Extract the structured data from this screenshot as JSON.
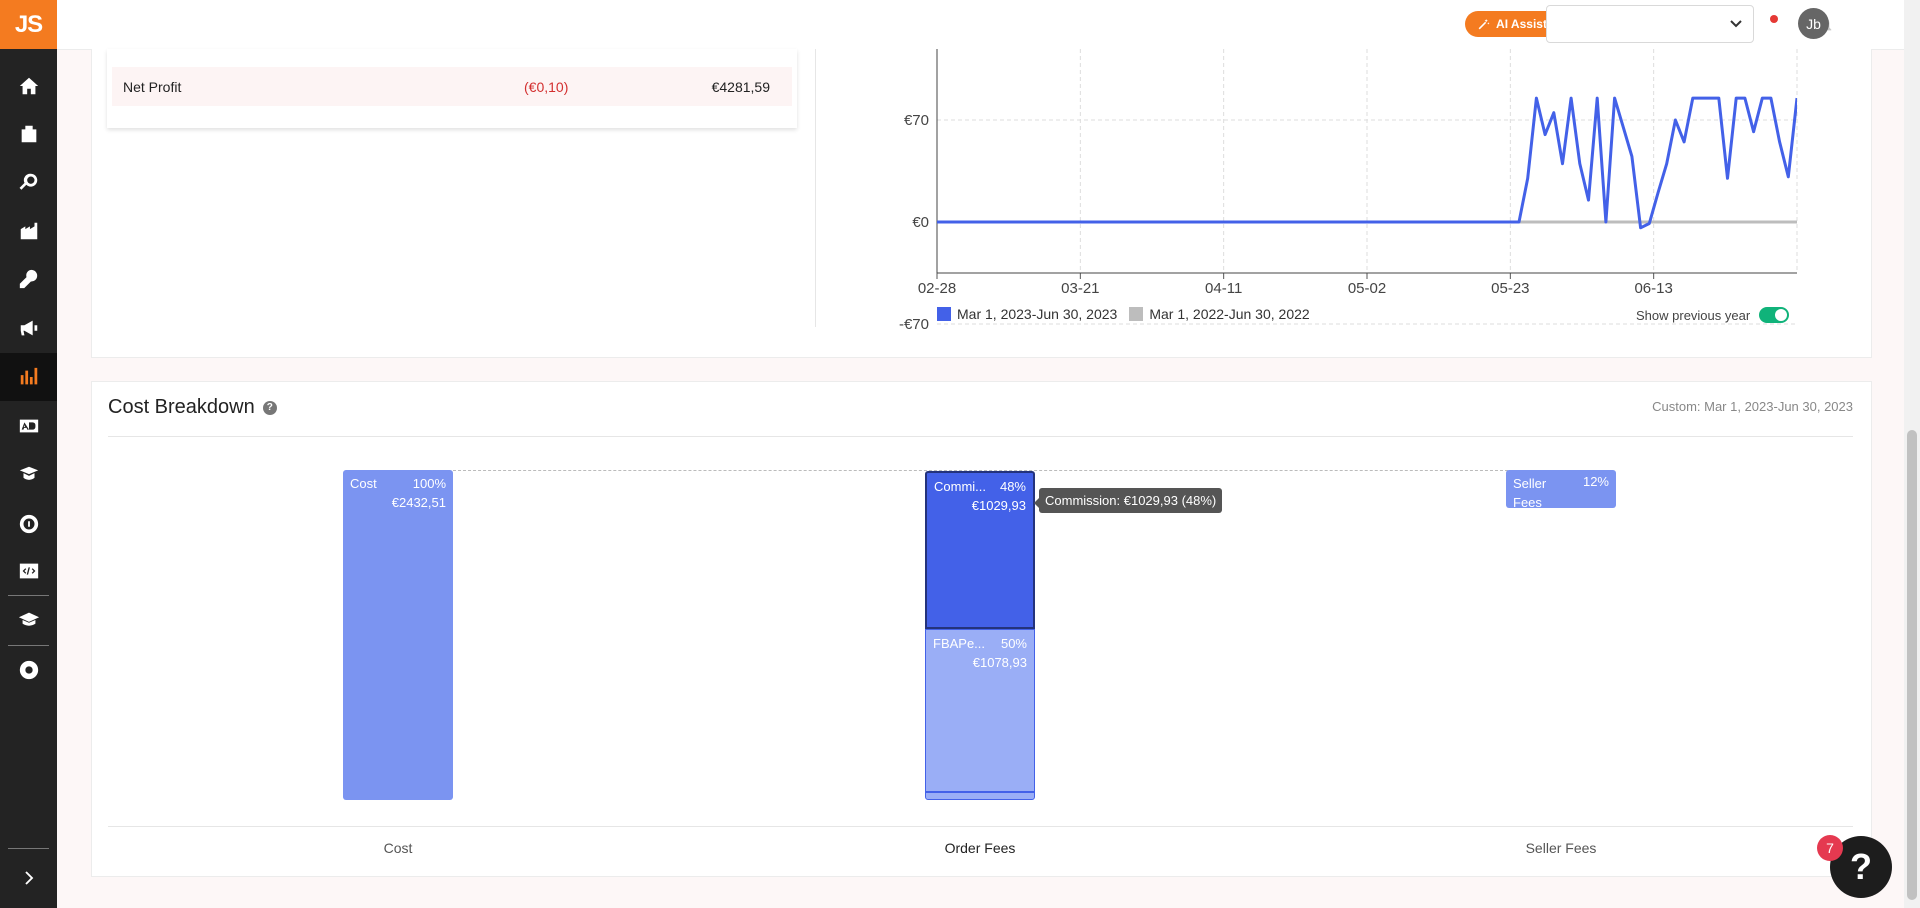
{
  "app": {
    "logo": "JS"
  },
  "sidebar": {
    "items": [
      {
        "name": "home-icon",
        "active": false
      },
      {
        "name": "products-icon",
        "active": false
      },
      {
        "name": "research-icon",
        "active": false
      },
      {
        "name": "supplier-icon",
        "active": false
      },
      {
        "name": "tools-icon",
        "active": false
      },
      {
        "name": "marketing-icon",
        "active": false
      },
      {
        "name": "analytics-icon",
        "active": true
      },
      {
        "name": "ads-icon",
        "active": false
      },
      {
        "name": "academy-icon",
        "active": false
      },
      {
        "name": "services-icon",
        "active": false
      },
      {
        "name": "developer-icon",
        "active": false
      },
      {
        "name": "learning-icon",
        "active": false
      },
      {
        "name": "chrome-extension-icon",
        "active": false
      }
    ]
  },
  "header": {
    "ai_chat_label": "AI Assist Chat",
    "marketplace_select_value": "",
    "avatar_initials": "Jb"
  },
  "profit_summary": {
    "net_profit_label": "Net Profit",
    "net_profit_change": "(€0,10)",
    "net_profit_value": "€4281,59"
  },
  "chart_data": {
    "type": "line",
    "y_ticks": [
      "€70",
      "€0",
      "-€70"
    ],
    "y_tick_values": [
      70,
      0,
      -70
    ],
    "x_ticks": [
      "02-28",
      "03-21",
      "04-11",
      "05-02",
      "05-23",
      "06-13"
    ],
    "ylim": [
      -70,
      70
    ],
    "grid": true,
    "legend_placement": "bottom-left",
    "series": [
      {
        "name": "Mar 1, 2023-Jun 30, 2023",
        "color": "#4361e8",
        "values": [
          0,
          0,
          0,
          0,
          0,
          0,
          0,
          0,
          0,
          0,
          0,
          0,
          0,
          0,
          0,
          0,
          0,
          0,
          0,
          0,
          0,
          0,
          0,
          0,
          0,
          0,
          0,
          0,
          0,
          0,
          0,
          0,
          0,
          0,
          0,
          0,
          0,
          0,
          0,
          0,
          0,
          0,
          0,
          0,
          0,
          0,
          0,
          0,
          0,
          0,
          0,
          0,
          0,
          0,
          0,
          0,
          0,
          0,
          0,
          0,
          0,
          0,
          0,
          0,
          0,
          0,
          0,
          0,
          30,
          85,
          60,
          75,
          40,
          85,
          40,
          15,
          85,
          0,
          85,
          65,
          45,
          -4,
          -1,
          20,
          40,
          70,
          55,
          85,
          85,
          85,
          85,
          30,
          85,
          85,
          62,
          85,
          85,
          55,
          31,
          85
        ]
      },
      {
        "name": "Mar 1, 2022-Jun 30, 2022",
        "color": "#bdbdbd",
        "values": [
          0
        ]
      }
    ]
  },
  "legend": {
    "series_1": "Mar 1, 2023-Jun 30, 2023",
    "series_2": "Mar 1, 2022-Jun 30, 2022",
    "series_1_color": "#4361e8",
    "series_2_color": "#bdbdbd",
    "show_previous_year_label": "Show previous year",
    "show_previous_year": true
  },
  "cost_breakdown": {
    "title": "Cost Breakdown",
    "date_range": "Custom: Mar 1, 2023-Jun 30, 2023",
    "bars": {
      "cost": {
        "label": "Cost",
        "pct": "100%",
        "amount": "€2432,51"
      },
      "commission": {
        "label": "Commi...",
        "pct": "48%",
        "amount": "€1029,93"
      },
      "fba": {
        "label": "FBAPe...",
        "pct": "50%",
        "amount": "€1078,93"
      },
      "seller_fees": {
        "label": "Seller Fees",
        "pct": "12%"
      }
    },
    "tooltip": "Commission: €1029,93 (48%)",
    "categories": [
      "Cost",
      "Order Fees",
      "Seller Fees"
    ]
  },
  "help": {
    "badge_count": "7",
    "icon": "?"
  }
}
